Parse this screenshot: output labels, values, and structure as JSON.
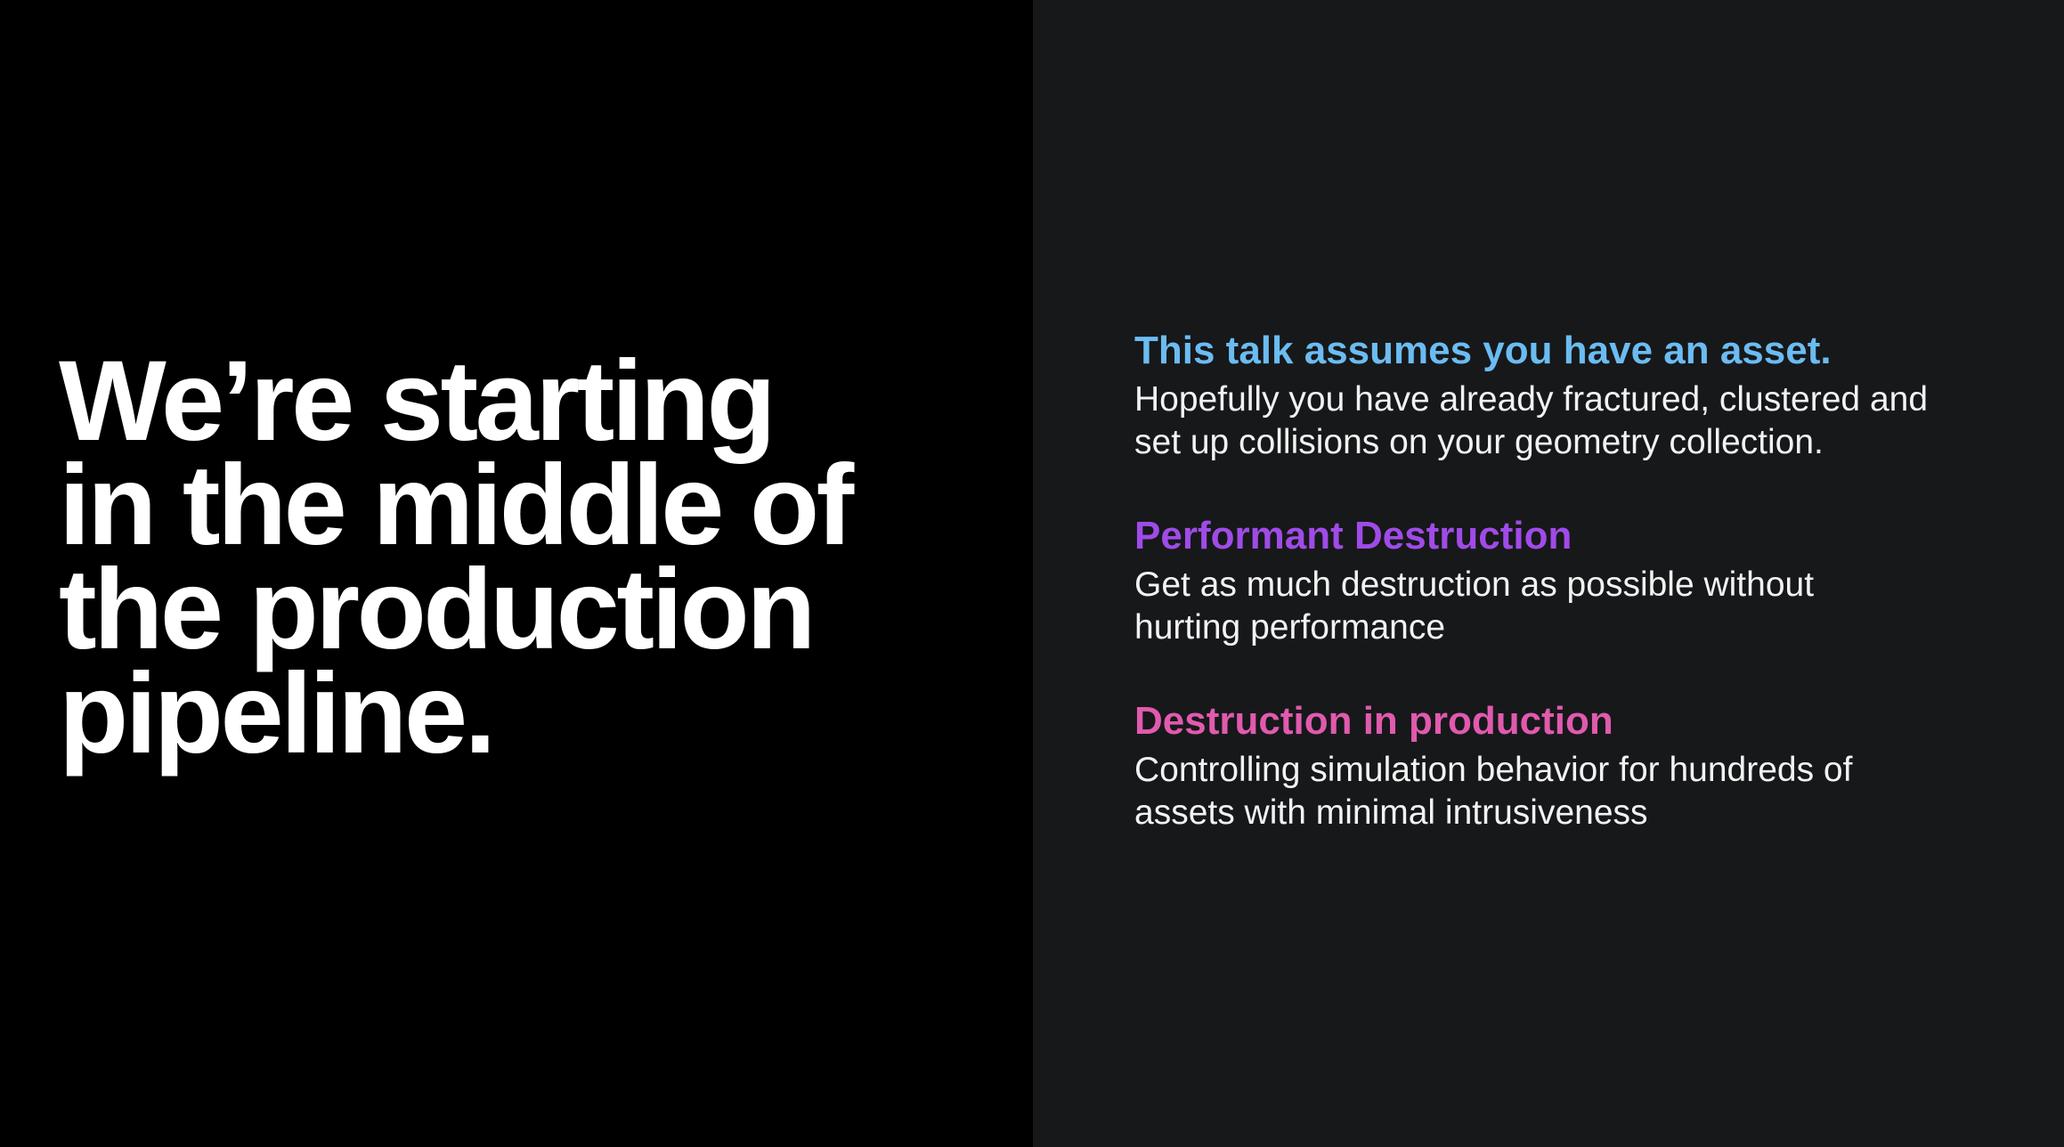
{
  "headline": {
    "lines": [
      "We’re starting",
      "in the middle of",
      "the production",
      "pipeline."
    ]
  },
  "points": [
    {
      "title": "This talk assumes you have an asset.",
      "color": "#6bbcf2",
      "lines": [
        "Hopefully you have already fractured, clustered and",
        "set up collisions on your geometry collection."
      ]
    },
    {
      "title": "Performant Destruction",
      "color": "#a04be8",
      "lines": [
        "Get as much destruction as possible without",
        "hurting performance"
      ]
    },
    {
      "title": "Destruction in production",
      "color": "#e05aae",
      "lines": [
        "Controlling simulation behavior for hundreds of",
        "assets with minimal intrusiveness"
      ]
    }
  ],
  "colors": {
    "left_background": "#000000",
    "right_background": "#17181a",
    "headline_text": "#ffffff",
    "body_text": "#f2f2f2"
  }
}
